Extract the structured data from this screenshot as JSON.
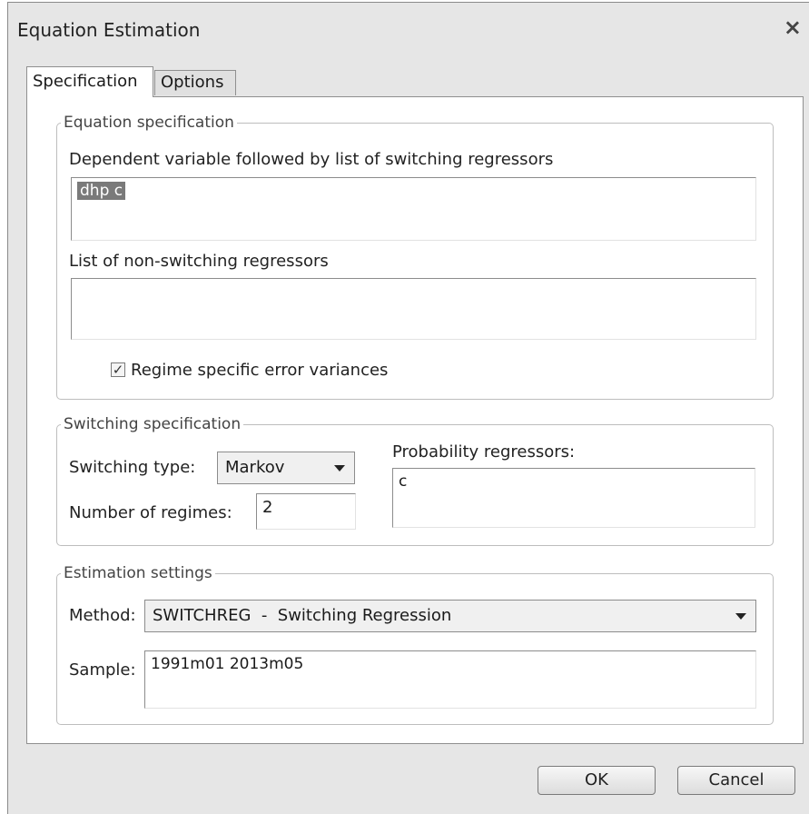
{
  "window": {
    "title": "Equation Estimation",
    "close_icon": "×"
  },
  "tabs": [
    {
      "label": "Specification",
      "active": true
    },
    {
      "label": "Options",
      "active": false
    }
  ],
  "equation_spec": {
    "legend": "Equation specification",
    "dependent_label": "Dependent variable followed by list of switching regressors",
    "dependent_value": "dhp c",
    "nonswitching_label": "List of non-switching regressors",
    "nonswitching_value": "",
    "regime_checkbox_label": "Regime specific error variances",
    "regime_checked": true
  },
  "switching_spec": {
    "legend": "Switching specification",
    "type_label": "Switching type:",
    "type_value": "Markov",
    "regimes_label": "Number of regimes:",
    "regimes_value": "2",
    "prob_label": "Probability regressors:",
    "prob_value": "c"
  },
  "estimation": {
    "legend": "Estimation settings",
    "method_label": "Method:",
    "method_value": "SWITCHREG  -  Switching Regression",
    "sample_label": "Sample:",
    "sample_value": "1991m01 2013m05"
  },
  "buttons": {
    "ok": "OK",
    "cancel": "Cancel"
  }
}
